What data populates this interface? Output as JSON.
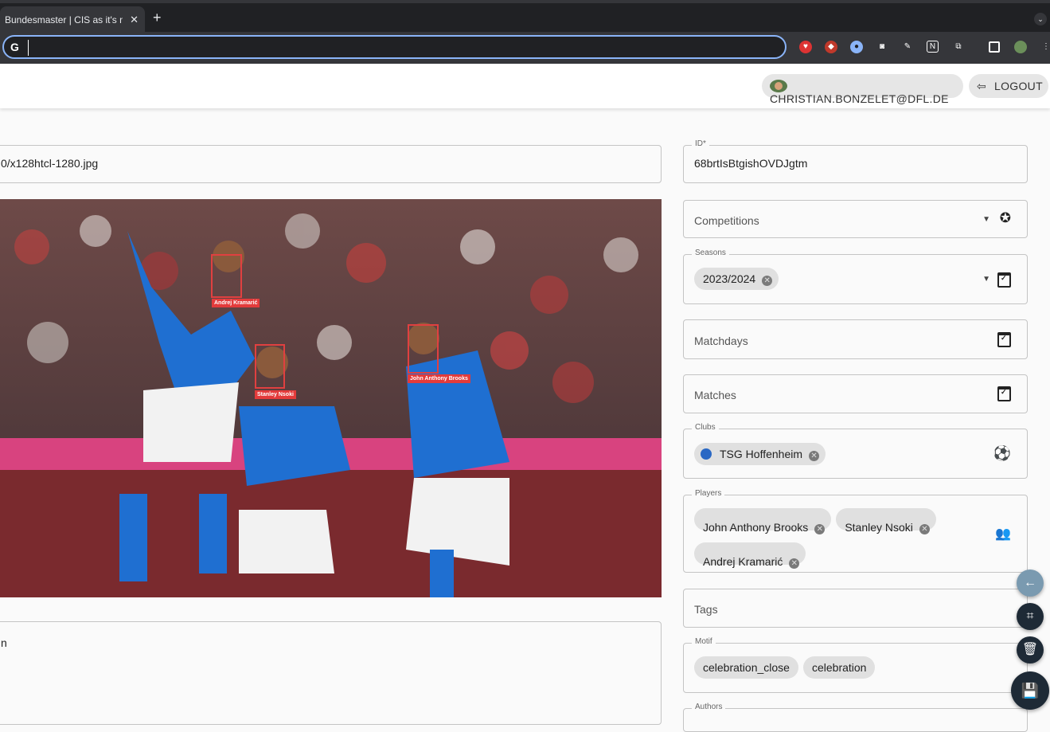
{
  "browser": {
    "tab_title": "Bundesmaster | CIS as it's meant",
    "tab_close": "✕",
    "new_tab": "+",
    "omnibox_value": ""
  },
  "header": {
    "user_email": "CHRISTIAN.BONZELET@DFL.DE",
    "logout_label": "LOGOUT"
  },
  "form": {
    "filename_value": "0/x128htcl-1280.jpg",
    "id": {
      "legend": "ID*",
      "value": "68brtIsBtgishOVDJgtm"
    },
    "competitions": {
      "placeholder": "Competitions"
    },
    "seasons": {
      "legend": "Seasons",
      "chips": [
        "2023/2024"
      ]
    },
    "matchdays": {
      "placeholder": "Matchdays"
    },
    "matches": {
      "placeholder": "Matches"
    },
    "clubs": {
      "legend": "Clubs",
      "chips": [
        "TSG Hoffenheim"
      ]
    },
    "players": {
      "legend": "Players",
      "chips": [
        "John Anthony Brooks",
        "Stanley Nsoki",
        "Andrej Kramarić"
      ]
    },
    "tags": {
      "placeholder": "Tags"
    },
    "motif": {
      "legend": "Motif",
      "chips": [
        "celebration_close",
        "celebration"
      ]
    },
    "authors": {
      "legend": "Authors"
    },
    "description_partial": "n"
  },
  "photo": {
    "faces": [
      {
        "label": "Andrej Kramarić"
      },
      {
        "label": "Stanley Nsoki"
      },
      {
        "label": "John Anthony Brooks"
      }
    ]
  },
  "colors": {
    "accent_fab": "#1e2a36",
    "back_fab": "#7a9ab0",
    "face_box": "#e04040"
  }
}
